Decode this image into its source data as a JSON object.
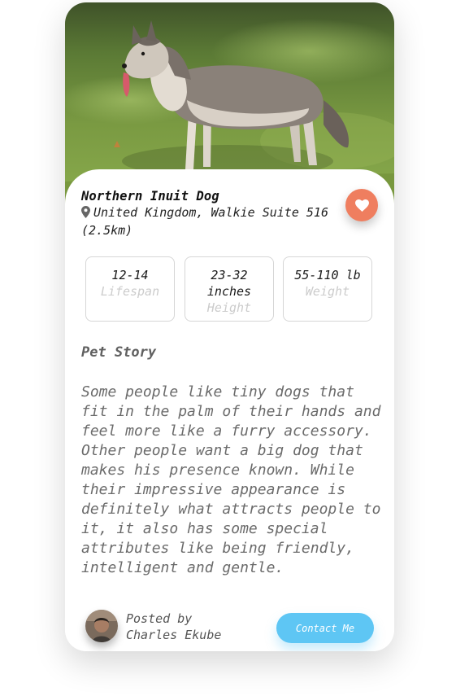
{
  "pet": {
    "name": "Northern Inuit Dog",
    "location": "United Kingdom, Walkie Suite 516 (2.5km)",
    "photo_icon": "dog-photo"
  },
  "favorite": {
    "icon": "heart-icon",
    "color": "#ef7e5f"
  },
  "stats": [
    {
      "value": "12-14",
      "label": "Lifespan"
    },
    {
      "value": "23-32 inches",
      "label": "Height"
    },
    {
      "value": "55-110 lb",
      "label": "Weight"
    }
  ],
  "story": {
    "title": "Pet Story",
    "body": "Some people like tiny dogs that fit in the palm of their hands and feel more like a furry accessory. Other people want a big dog that makes his presence known. While their impressive appearance is definitely what attracts people to it, it also has some special attributes like being friendly, intelligent and gentle."
  },
  "poster": {
    "prefix": "Posted by",
    "name": "Charles Ekube"
  },
  "contact": {
    "label": "Contact Me",
    "color": "#5ec6f4"
  }
}
